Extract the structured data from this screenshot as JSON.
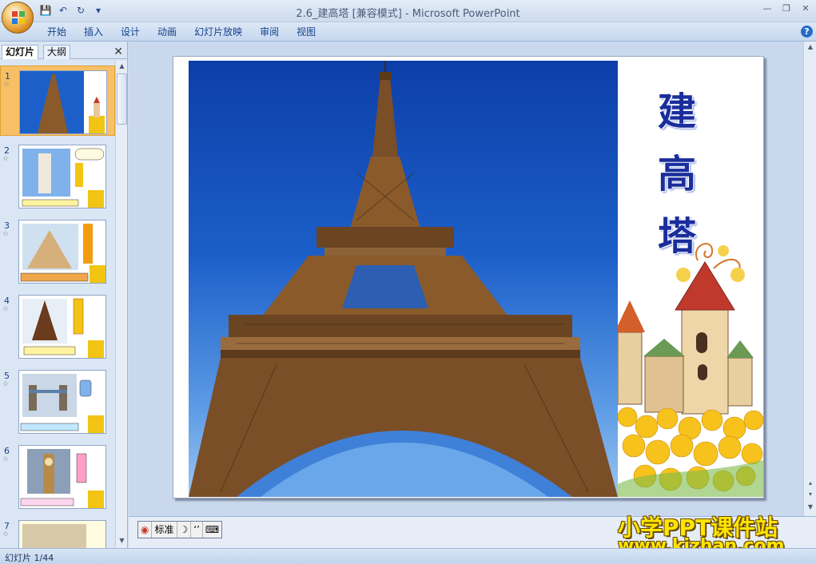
{
  "window": {
    "title": "2.6_建高塔 [兼容模式] - Microsoft PowerPoint"
  },
  "quick_access": {
    "icons": [
      "save-icon",
      "undo-icon",
      "redo-icon",
      "customize-icon"
    ]
  },
  "ribbon": {
    "tabs": [
      "开始",
      "插入",
      "设计",
      "动画",
      "幻灯片放映",
      "审阅",
      "视图"
    ],
    "help_label": "?"
  },
  "left_pane": {
    "tabs": [
      "幻灯片",
      "大纲"
    ],
    "close_label": "✕",
    "slides": [
      {
        "number": "1",
        "star": "☆",
        "selected": true
      },
      {
        "number": "2",
        "star": "☆",
        "selected": false
      },
      {
        "number": "3",
        "star": "☆",
        "selected": false
      },
      {
        "number": "4",
        "star": "☆",
        "selected": false
      },
      {
        "number": "5",
        "star": "☆",
        "selected": false
      },
      {
        "number": "6",
        "star": "☆",
        "selected": false
      },
      {
        "number": "7",
        "star": "☆",
        "selected": false
      }
    ]
  },
  "slide": {
    "title_chars": [
      "建",
      "高",
      "塔"
    ]
  },
  "ime_bar": {
    "mode_label": "标准"
  },
  "watermark": {
    "line1": "小学PPT课件站",
    "line2": "www.kjzhan.com"
  },
  "status": {
    "slide_counter": "幻灯片 1/44"
  },
  "colors": {
    "title_blue": "#1a2d9c",
    "sky_blue": "#1c5fc9",
    "tower_brown": "#8a5a2b",
    "selected_thumb": "#f7c067",
    "watermark_yellow": "#ffe500"
  }
}
